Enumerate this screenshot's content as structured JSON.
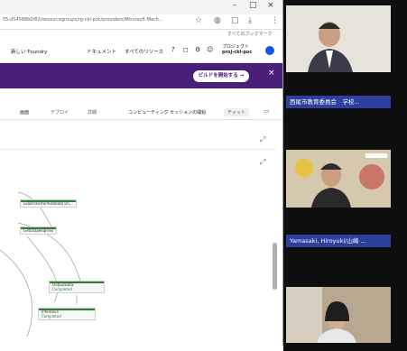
{
  "browser": {
    "url_text": "55-d54588b0/82/resourcegroups/rg-ckl-poc/providers/Microsoft.Mach...",
    "bookmarks_label": "すべてのブックマーク",
    "window_controls": [
      "–",
      "□",
      "×"
    ]
  },
  "appbar": {
    "items": [
      "新しい Foundry",
      "ドキュメント",
      "すべてのリソース"
    ],
    "project_label": "プロジェクト",
    "project_name": "proj-ckl-poc"
  },
  "banner": {
    "button_label": "ビルドを開始する →"
  },
  "toolbar": {
    "items": [
      "画面",
      "デプロイ",
      "詳細",
      "コンピューティング セッションの開始",
      "チャット"
    ]
  },
  "pipeline_nodes": [
    {
      "label": "LoadTransformedData Un...",
      "status": ""
    },
    {
      "label": "GetDataReqFiles",
      "status": ""
    },
    {
      "label": "OutputData",
      "status": "Completed"
    },
    {
      "label": "Inference",
      "status": "Completed"
    }
  ],
  "video_tiles": [
    {
      "name": "",
      "bg": "#e6e3db"
    },
    {
      "name": "西尾市教育委員会　学校...",
      "bg": "#c8b89a"
    },
    {
      "name": "Yamasaki, Hiroyuki/山崎 ...",
      "bg": "#a89a88"
    }
  ]
}
